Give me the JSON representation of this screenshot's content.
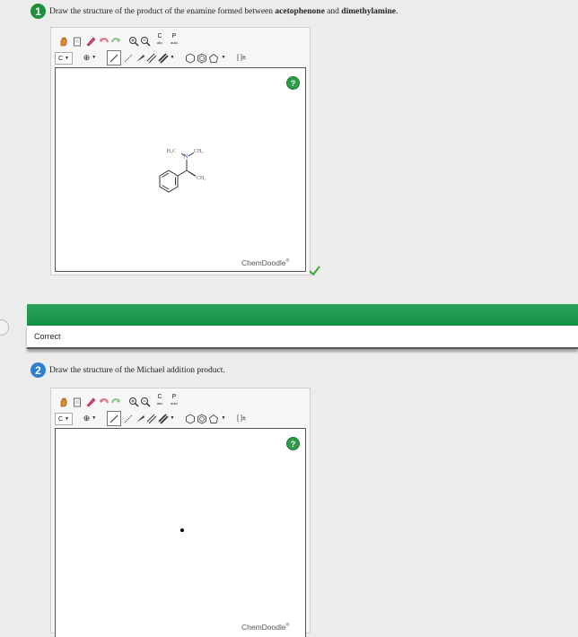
{
  "question1": {
    "number": "1",
    "text_prefix": "Draw the structure of the product of the enamine formed between ",
    "reagent1": "acetophenone",
    "connector": " and ",
    "reagent2": "dimethylamine",
    "text_suffix": "."
  },
  "question2": {
    "number": "2",
    "text": "Draw the structure of the Michael addition product."
  },
  "toolbar": {
    "element_select": "C",
    "charge_plus": "⊕",
    "text_label_c": "C",
    "text_label_c_sub": "abc",
    "text_label_p": "P",
    "text_label_p_sub": "auto",
    "bracket_label": "[ ]±"
  },
  "editor": {
    "brand": "ChemDoodle",
    "brand_reg": "®",
    "help": "?"
  },
  "structure": {
    "label_h3c": "H₃C",
    "label_n": "N",
    "label_ch3": "CH₃",
    "label_ch2": "CH₂"
  },
  "feedback": {
    "status": "Correct"
  },
  "colors": {
    "banner": "#1f9a50",
    "question1_badge": "#1e8f3b",
    "question2_badge": "#2f7fd0",
    "check": "#3aa83a",
    "nitrogen": "#3a5fd0"
  }
}
